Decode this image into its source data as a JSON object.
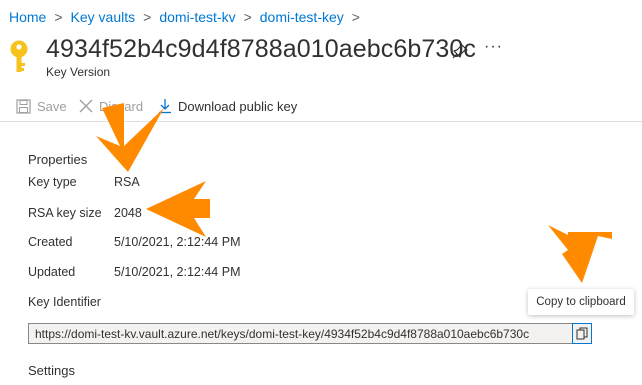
{
  "breadcrumb": [
    "Home",
    "Key vaults",
    "domi-test-kv",
    "domi-test-key"
  ],
  "header": {
    "title": "4934f52b4c9d4f8788a010aebc6b730c",
    "subtitle": "Key Version",
    "more": "···"
  },
  "toolbar": {
    "save_label": "Save",
    "discard_label": "Discard",
    "download_label": "Download public key"
  },
  "properties": {
    "heading": "Properties",
    "items": [
      {
        "label": "Key type",
        "value": "RSA"
      },
      {
        "label": "RSA key size",
        "value": "2048"
      },
      {
        "label": "Created",
        "value": "5/10/2021, 2:12:44 PM"
      },
      {
        "label": "Updated",
        "value": "5/10/2021, 2:12:44 PM"
      }
    ]
  },
  "key_identifier": {
    "label": "Key Identifier",
    "value": "https://domi-test-kv.vault.azure.net/keys/domi-test-key/4934f52b4c9d4f8788a010aebc6b730c",
    "copy_tooltip": "Copy to clipboard"
  },
  "settings": {
    "heading": "Settings"
  },
  "colors": {
    "link": "#0078d4",
    "key_icon": "#f8c21c",
    "annotation_arrow": "#ff8a00",
    "disabled_text": "#a19f9d"
  },
  "icons": [
    "key-icon",
    "pin-icon",
    "save-icon",
    "discard-icon",
    "download-icon",
    "copy-icon"
  ]
}
